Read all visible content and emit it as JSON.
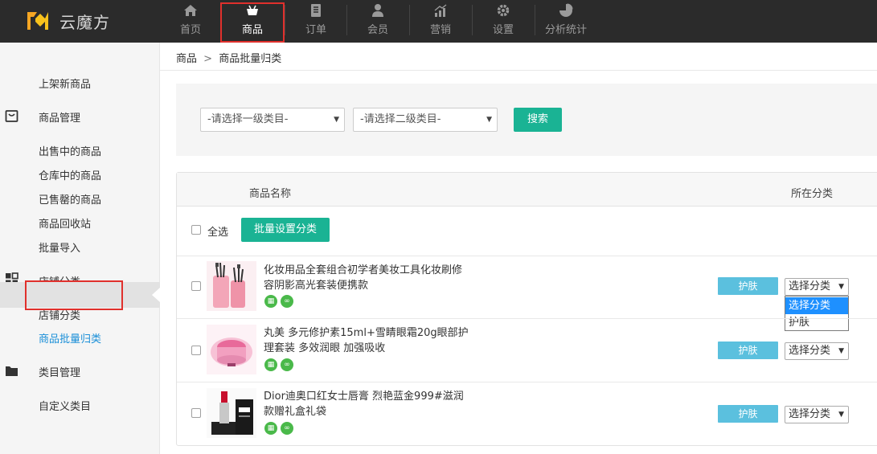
{
  "app": {
    "name": "云魔方"
  },
  "nav": [
    {
      "label": "首页",
      "icon": "home-icon"
    },
    {
      "label": "商品",
      "icon": "shopping-basket-icon",
      "active": true
    },
    {
      "label": "订单",
      "icon": "order-icon"
    },
    {
      "label": "会员",
      "icon": "member-icon"
    },
    {
      "label": "营销",
      "icon": "marketing-icon"
    },
    {
      "label": "设置",
      "icon": "gear-icon"
    },
    {
      "label": "分析统计",
      "icon": "pie-chart-icon"
    }
  ],
  "sidebar": {
    "new_product": "上架新商品",
    "product_mgmt": "商品管理",
    "on_sale": "出售中的商品",
    "in_warehouse": "仓库中的商品",
    "sold_out": "已售罄的商品",
    "recycle_bin": "商品回收站",
    "batch_import": "批量导入",
    "store_category": "店铺分类",
    "store_category_sub": "店铺分类",
    "batch_categorize": "商品批量归类",
    "category_mgmt": "类目管理",
    "custom_category": "自定义类目"
  },
  "breadcrumb": {
    "root": "商品",
    "sep": ">",
    "current": "商品批量归类"
  },
  "filters": {
    "level1_placeholder": "-请选择一级类目-",
    "level2_placeholder": "-请选择二级类目-",
    "search_label": "搜索"
  },
  "table": {
    "col_name": "商品名称",
    "col_category": "所在分类",
    "select_all": "全选",
    "batch_button": "批量设置分类",
    "rows": [
      {
        "name": "化妆用品全套组合初学者美妆工具化妆刷修容阴影高光套装便携款",
        "category": "护肤",
        "select": "选择分类"
      },
      {
        "name": "丸美 多元修护素15ml+雪睛眼霜20g眼部护理套装 多效润眼 加强吸收",
        "category": "护肤",
        "select": "选择分类"
      },
      {
        "name": "Dior迪奥口红女士唇膏 烈艳蓝金999#滋润款赠礼盒礼袋",
        "category": "护肤",
        "select": "选择分类"
      }
    ],
    "dropdown_options": [
      "选择分类",
      "护肤"
    ]
  },
  "colors": {
    "accent": "#1ab394",
    "badge": "#5bc0de",
    "highlight": "#e0302c",
    "topbar": "#2b2b2b"
  }
}
